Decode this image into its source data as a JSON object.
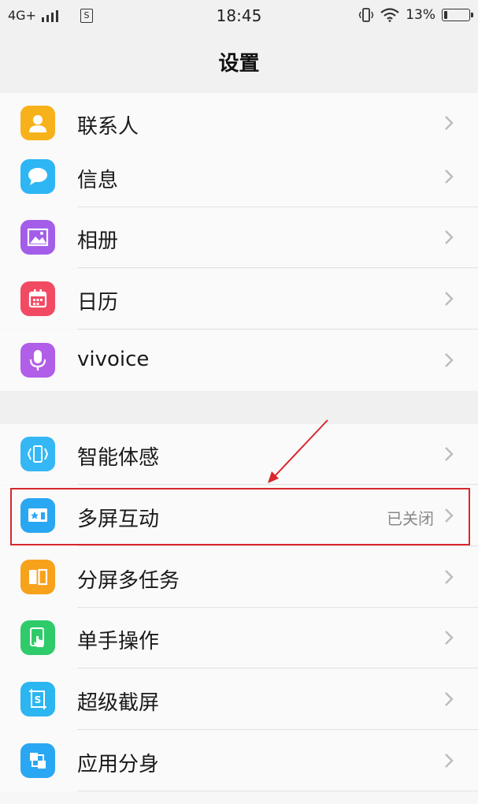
{
  "status_bar": {
    "network": "4G+",
    "time": "18:45",
    "battery_percent": "13%",
    "battery_level": 0.13,
    "icons": [
      "signal-icon",
      "sim-icon",
      "vibrate-icon",
      "wifi-icon",
      "battery-icon"
    ]
  },
  "header": {
    "title": "设置"
  },
  "colors": {
    "highlight": "#d9272b"
  },
  "list": {
    "group1": [
      {
        "label": "联系人",
        "icon": "contacts-icon",
        "color": "#f7b21b"
      },
      {
        "label": "信息",
        "icon": "messages-icon",
        "color": "#2eb6f4"
      },
      {
        "label": "相册",
        "icon": "gallery-icon",
        "color": "#a35de8"
      },
      {
        "label": "日历",
        "icon": "calendar-icon",
        "color": "#f24a62"
      },
      {
        "label": "vivoice",
        "icon": "microphone-icon",
        "color": "#b15ee8"
      }
    ],
    "group2": [
      {
        "label": "智能体感",
        "icon": "smart-motion-icon",
        "color": "#35b7f6"
      },
      {
        "label": "多屏互动",
        "value": "已关闭",
        "icon": "multi-screen-icon",
        "color": "#2aa7f2"
      },
      {
        "label": "分屏多任务",
        "icon": "split-screen-icon",
        "color": "#f7a21b"
      },
      {
        "label": "单手操作",
        "icon": "one-hand-icon",
        "color": "#2fcb6a"
      },
      {
        "label": "超级截屏",
        "icon": "screenshot-icon",
        "color": "#2bb5f1"
      },
      {
        "label": "应用分身",
        "icon": "app-clone-icon",
        "color": "#2aa7f2"
      }
    ]
  }
}
